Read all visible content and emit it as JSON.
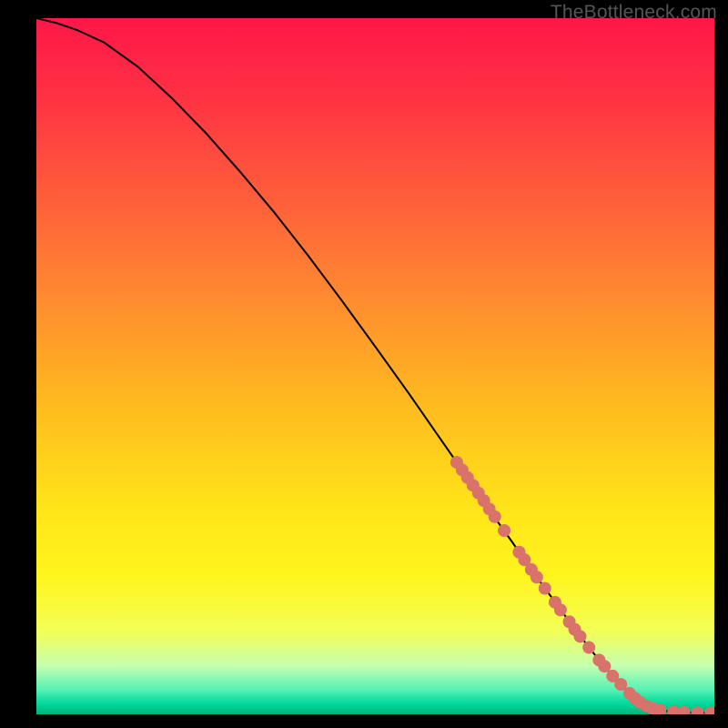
{
  "watermark": "TheBottleneck.com",
  "colors": {
    "frame_bg": "#000000",
    "curve": "#000000",
    "marker_fill": "#d9726a",
    "marker_stroke": "#d9726a",
    "gradient_stops": [
      {
        "offset": 0.0,
        "color": "#ff1748"
      },
      {
        "offset": 0.1,
        "color": "#ff2e44"
      },
      {
        "offset": 0.25,
        "color": "#ff5b3b"
      },
      {
        "offset": 0.4,
        "color": "#ff8a30"
      },
      {
        "offset": 0.55,
        "color": "#ffb91f"
      },
      {
        "offset": 0.7,
        "color": "#ffe31a"
      },
      {
        "offset": 0.8,
        "color": "#fff51c"
      },
      {
        "offset": 0.88,
        "color": "#f3ff55"
      },
      {
        "offset": 0.93,
        "color": "#c6ffb0"
      },
      {
        "offset": 0.965,
        "color": "#55f2b5"
      },
      {
        "offset": 0.985,
        "color": "#00d89a"
      },
      {
        "offset": 1.0,
        "color": "#00b37a"
      }
    ]
  },
  "chart_data": {
    "type": "line",
    "title": "",
    "xlabel": "",
    "ylabel": "",
    "xlim": [
      0,
      100
    ],
    "ylim": [
      0,
      100
    ],
    "grid": false,
    "legend": false,
    "series": [
      {
        "name": "curve",
        "x": [
          0,
          3,
          6,
          10,
          15,
          20,
          25,
          30,
          35,
          40,
          45,
          50,
          55,
          60,
          62,
          65,
          70,
          73,
          76,
          79,
          82,
          85,
          88,
          90,
          92,
          94,
          96,
          98,
          100
        ],
        "y": [
          100,
          99.3,
          98.3,
          96.5,
          93.0,
          88.5,
          83.5,
          78.0,
          72.2,
          66.0,
          59.5,
          52.8,
          46.0,
          39.0,
          36.2,
          31.8,
          25.0,
          20.8,
          16.8,
          12.8,
          9.0,
          5.5,
          2.5,
          1.2,
          0.6,
          0.35,
          0.25,
          0.2,
          0.2
        ]
      }
    ],
    "markers": [
      {
        "x": 62.0,
        "y": 36.2
      },
      {
        "x": 62.8,
        "y": 35.1
      },
      {
        "x": 63.6,
        "y": 34.0
      },
      {
        "x": 64.4,
        "y": 32.9
      },
      {
        "x": 65.2,
        "y": 31.8
      },
      {
        "x": 66.0,
        "y": 30.7
      },
      {
        "x": 66.8,
        "y": 29.5
      },
      {
        "x": 67.6,
        "y": 28.4
      },
      {
        "x": 69.0,
        "y": 26.4
      },
      {
        "x": 71.2,
        "y": 23.3
      },
      {
        "x": 72.0,
        "y": 22.2
      },
      {
        "x": 73.0,
        "y": 20.8
      },
      {
        "x": 73.8,
        "y": 19.7
      },
      {
        "x": 75.0,
        "y": 18.1
      },
      {
        "x": 76.5,
        "y": 16.1
      },
      {
        "x": 77.3,
        "y": 15.0
      },
      {
        "x": 78.6,
        "y": 13.3
      },
      {
        "x": 79.4,
        "y": 12.2
      },
      {
        "x": 80.2,
        "y": 11.2
      },
      {
        "x": 81.5,
        "y": 9.6
      },
      {
        "x": 83.0,
        "y": 7.8
      },
      {
        "x": 83.8,
        "y": 6.9
      },
      {
        "x": 85.0,
        "y": 5.5
      },
      {
        "x": 86.2,
        "y": 4.3
      },
      {
        "x": 87.5,
        "y": 3.0
      },
      {
        "x": 88.3,
        "y": 2.3
      },
      {
        "x": 89.1,
        "y": 1.7
      },
      {
        "x": 90.0,
        "y": 1.2
      },
      {
        "x": 91.0,
        "y": 0.8
      },
      {
        "x": 92.0,
        "y": 0.6
      },
      {
        "x": 94.0,
        "y": 0.35
      },
      {
        "x": 95.5,
        "y": 0.28
      },
      {
        "x": 97.5,
        "y": 0.22
      },
      {
        "x": 99.5,
        "y": 0.2
      }
    ]
  }
}
